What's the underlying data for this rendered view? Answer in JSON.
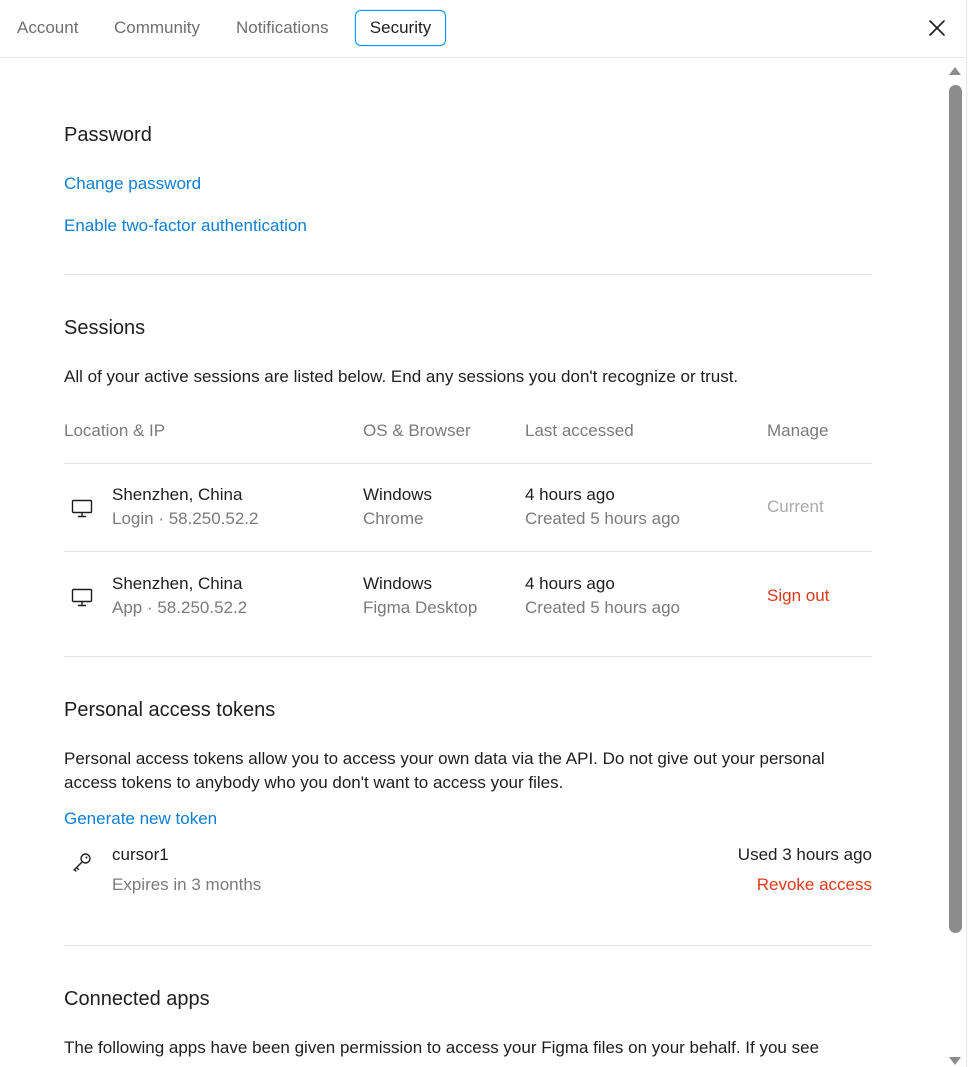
{
  "tabs": [
    {
      "label": "Account"
    },
    {
      "label": "Community"
    },
    {
      "label": "Notifications"
    },
    {
      "label": "Security"
    }
  ],
  "active_tab": "Security",
  "password": {
    "title": "Password",
    "change_link": "Change password",
    "two_factor_link": "Enable two-factor authentication"
  },
  "sessions": {
    "title": "Sessions",
    "description": "All of your active sessions are listed below. End any sessions you don't recognize or trust.",
    "columns": {
      "location": "Location & IP",
      "os": "OS & Browser",
      "last": "Last accessed",
      "manage": "Manage"
    },
    "rows": [
      {
        "icon": "monitor-icon",
        "location": "Shenzhen, China",
        "ip": "Login · 58.250.52.2",
        "os": "Windows",
        "browser": "Chrome",
        "last": "4 hours ago",
        "created": "Created 5 hours ago",
        "manage": "Current"
      },
      {
        "icon": "monitor-icon",
        "location": "Shenzhen, China",
        "ip": "App · 58.250.52.2",
        "os": "Windows",
        "browser": "Figma Desktop",
        "last": "4 hours ago",
        "created": "Created 5 hours ago",
        "manage": "Sign out"
      }
    ]
  },
  "tokens": {
    "title": "Personal access tokens",
    "description": "Personal access tokens allow you to access your own data via the API. Do not give out your personal access tokens to anybody who you don't want to access your files.",
    "generate_link": "Generate new token",
    "items": [
      {
        "icon": "key-icon",
        "name": "cursor1",
        "expires": "Expires in 3 months",
        "used": "Used 3 hours ago",
        "revoke": "Revoke access"
      }
    ]
  },
  "connected_apps": {
    "title": "Connected apps",
    "description": "The following apps have been given permission to access your Figma files on your behalf. If you see"
  },
  "colors": {
    "link": "#0d7ed8",
    "danger": "#de3a1a",
    "active_tab_border": "#0d99ff",
    "muted": "#7b7b7b"
  }
}
